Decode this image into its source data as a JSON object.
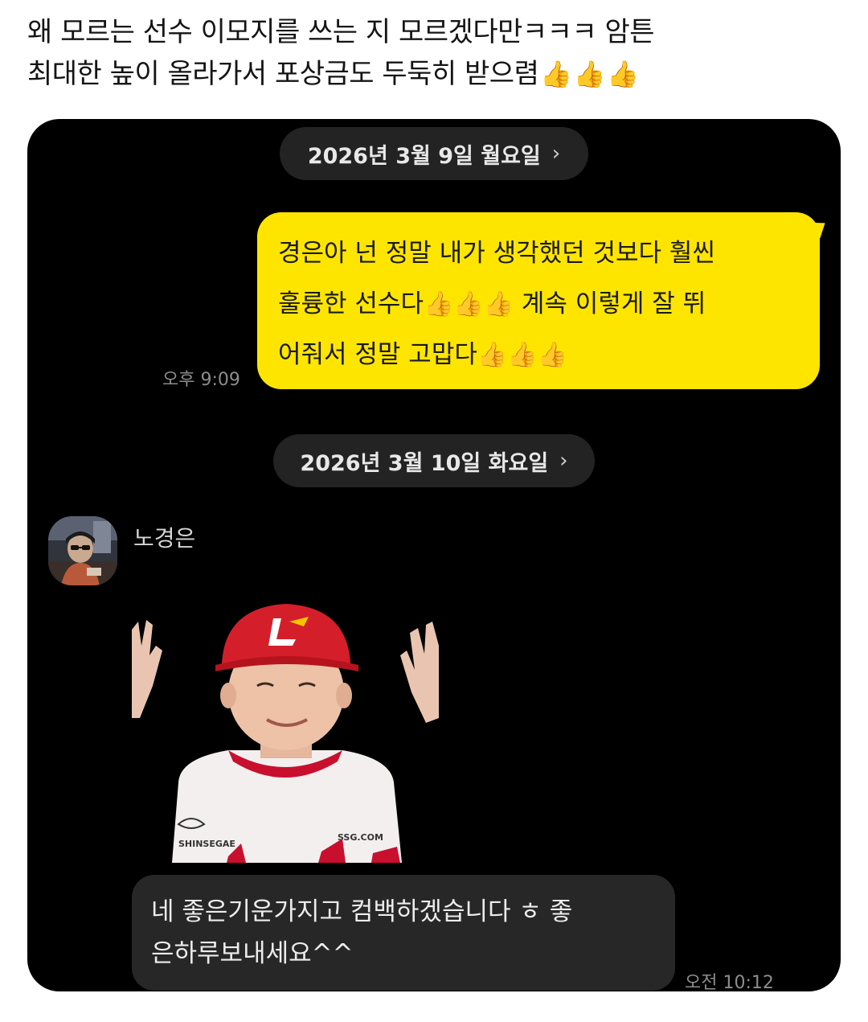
{
  "post": {
    "caption_line1": "왜 모르는 선수 이모지를 쓰는 지 모르겠다만ㅋㅋㅋ 암튼",
    "caption_line2": "최대한 높이 올라가서 포상금도 두둑히 받으렴",
    "caption_emojis": [
      "👍",
      "👍",
      "👍"
    ]
  },
  "chat": {
    "date_divider_1": "2026년 3월 9일 월요일",
    "date_divider_2": "2026년 3월 10일 화요일",
    "chevron": "›",
    "outgoing": {
      "line1": "경은아 넌 정말 내가 생각했던 것보다 훨씬",
      "line2_a": "훌륭한 선수다",
      "line2_b": " 계속 이렇게 잘 뛰",
      "line3": "어줘서 정말 고맙다",
      "emoji": "👍",
      "time": "오후 9:09"
    },
    "incoming": {
      "sender": "노경은",
      "sticker_label_1": "SHINSEGAE",
      "sticker_label_2": "SSG.COM",
      "line1": "네 좋은기운가지고 컴백하겠습니다 ㅎ 좋",
      "line2": "은하루보내세요^^",
      "time": "오전 10:12"
    },
    "colors": {
      "outgoing_bubble": "#fee500",
      "incoming_bubble": "#272727",
      "background": "#000000",
      "date_pill": "#232323"
    }
  }
}
